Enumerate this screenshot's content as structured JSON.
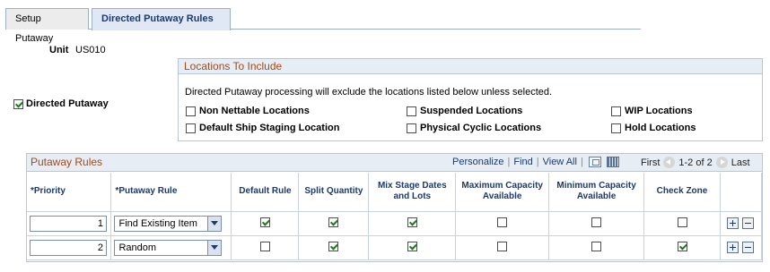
{
  "tabs": [
    {
      "label": "Setup Putaway",
      "active": false
    },
    {
      "label": "Directed Putaway Rules",
      "active": true
    }
  ],
  "unit": {
    "label": "Unit",
    "value": "US010"
  },
  "directed_putaway": {
    "label": "Directed Putaway",
    "checked": true
  },
  "locations": {
    "title": "Locations To Include",
    "description": "Directed Putaway processing will exclude the locations listed below unless selected.",
    "items": [
      {
        "label": "Non Nettable Locations",
        "checked": false
      },
      {
        "label": "Suspended Locations",
        "checked": false
      },
      {
        "label": "WIP Locations",
        "checked": false
      },
      {
        "label": "Default Ship Staging Location",
        "checked": false
      },
      {
        "label": "Physical Cyclic Locations",
        "checked": false
      },
      {
        "label": "Hold Locations",
        "checked": false
      }
    ]
  },
  "grid": {
    "title": "Putaway Rules",
    "nav": {
      "personalize": "Personalize",
      "find": "Find",
      "view_all": "View All"
    },
    "pager": {
      "first": "First",
      "range": "1-2 of 2",
      "last": "Last"
    },
    "columns": [
      "*Priority",
      "*Putaway Rule",
      "Default Rule",
      "Split Quantity",
      "Mix Stage Dates and Lots",
      "Maximum Capacity Available",
      "Minimum Capacity Available",
      "Check Zone"
    ],
    "rows": [
      {
        "priority": "1",
        "rule": "Find Existing Item",
        "default_rule": true,
        "split_quantity": true,
        "mix_stage": true,
        "max_capacity": false,
        "min_capacity": false,
        "check_zone": false
      },
      {
        "priority": "2",
        "rule": "Random",
        "default_rule": false,
        "split_quantity": true,
        "mix_stage": true,
        "max_capacity": false,
        "min_capacity": false,
        "check_zone": true
      }
    ]
  },
  "colors": {
    "accent_text": "#1a3a70",
    "section_title": "#a34a1a",
    "header_bg": "#e7edf4",
    "check_green": "#1c7a1c"
  }
}
